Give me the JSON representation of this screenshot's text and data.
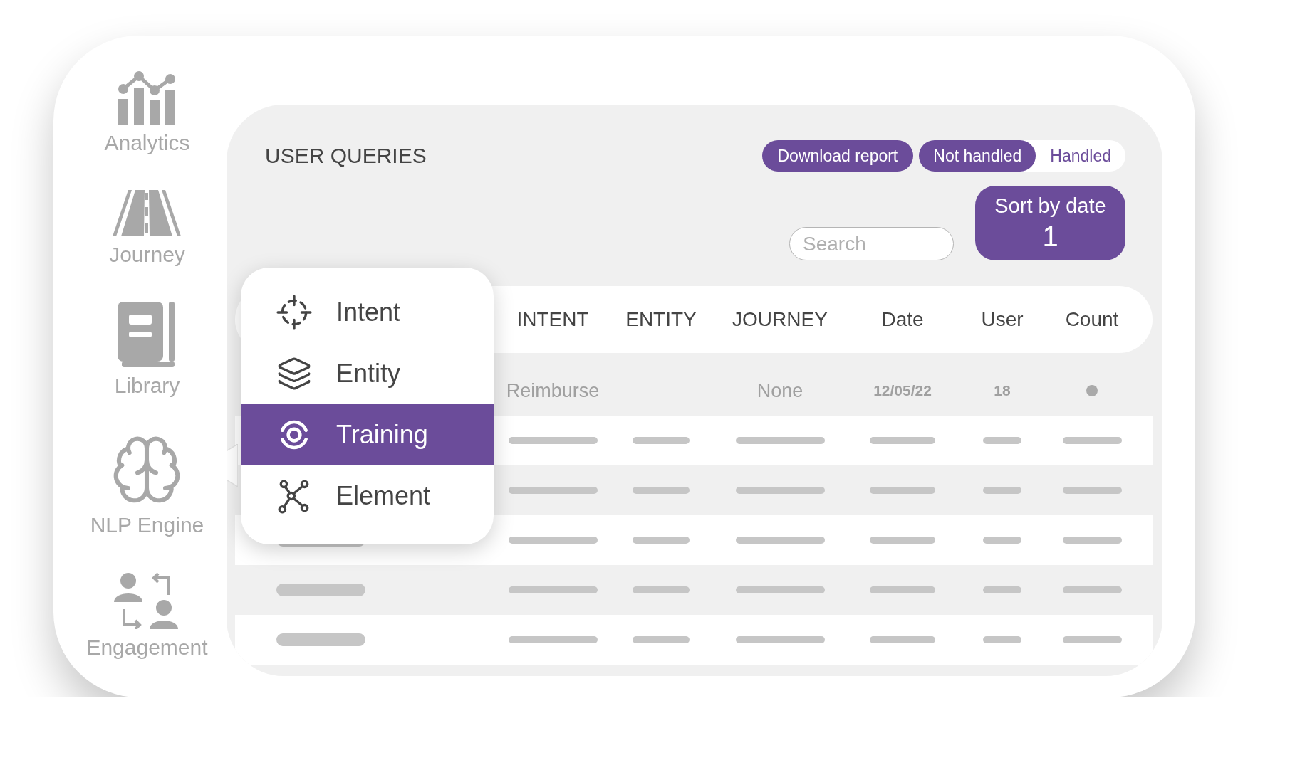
{
  "sidebar": {
    "items": [
      {
        "label": "Analytics"
      },
      {
        "label": "Journey"
      },
      {
        "label": "Library"
      },
      {
        "label": "NLP Engine"
      },
      {
        "label": "Engagement"
      }
    ]
  },
  "panel": {
    "title": "USER QUERIES",
    "download_button": "Download report",
    "filter_toggle": [
      {
        "label": "Not handled",
        "selected": true
      },
      {
        "label": "Handled",
        "selected": false
      }
    ],
    "search": {
      "placeholder": "Search"
    },
    "sort_button": {
      "label": "Sort by date",
      "value": "1"
    },
    "table": {
      "columns": [
        "INTENT",
        "ENTITY",
        "JOURNEY",
        "Date",
        "User",
        "Count"
      ],
      "rows": [
        {
          "kind": "text",
          "intent": "Reimburse",
          "journey": "None",
          "date": "12/05/22",
          "user": "18"
        },
        {
          "kind": "placeholder"
        },
        {
          "kind": "placeholder"
        },
        {
          "kind": "placeholder"
        },
        {
          "kind": "placeholder"
        },
        {
          "kind": "placeholder"
        }
      ]
    }
  },
  "context_menu": {
    "items": [
      {
        "label": "Intent",
        "selected": false
      },
      {
        "label": "Entity",
        "selected": false
      },
      {
        "label": "Training",
        "selected": true
      },
      {
        "label": "Element",
        "selected": false
      }
    ]
  }
}
